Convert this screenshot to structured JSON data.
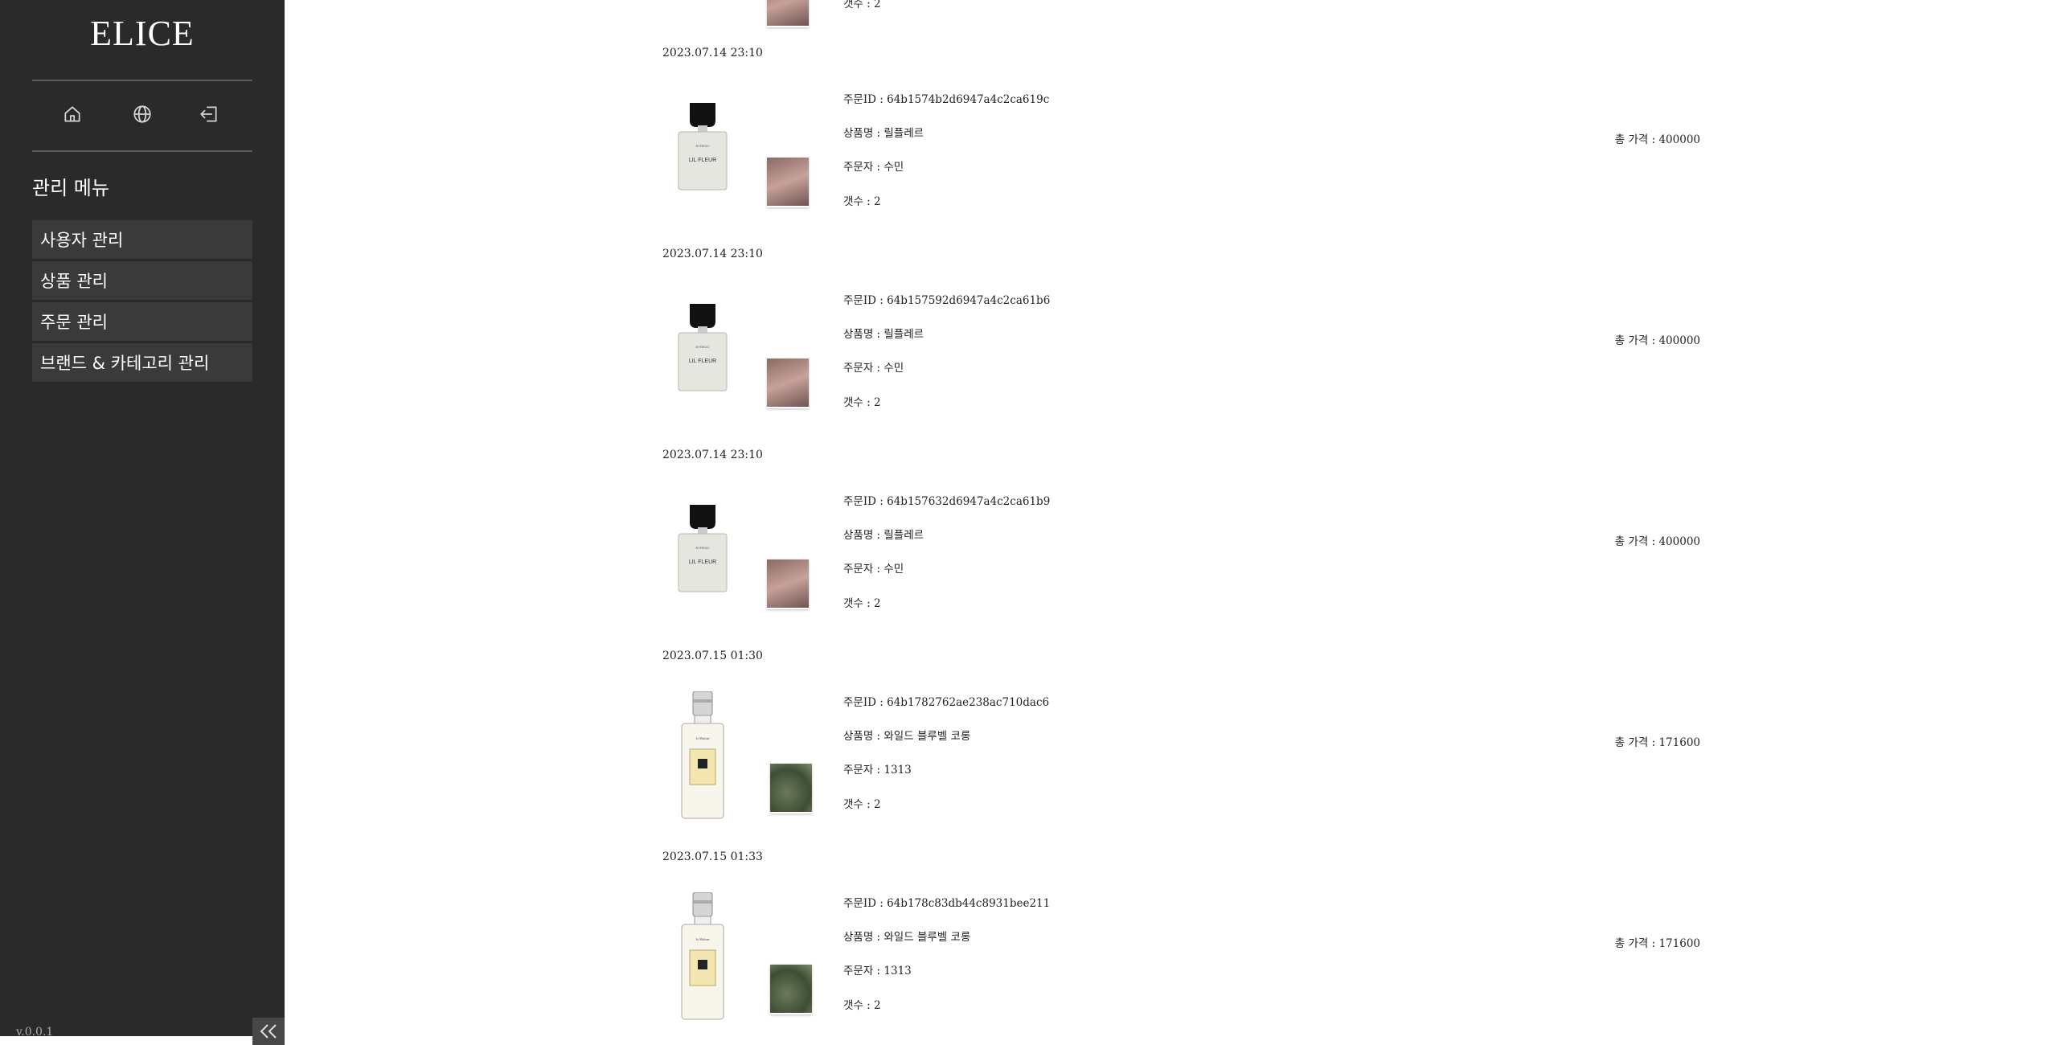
{
  "sidebar": {
    "logo": "ELICE",
    "icons": [
      "home-icon",
      "globe-icon",
      "logout-icon"
    ],
    "menu_title": "관리 메뉴",
    "menu_items": [
      {
        "label": "사용자 관리"
      },
      {
        "label": "상품 관리"
      },
      {
        "label": "주문 관리"
      },
      {
        "label": "브랜드 & 카테고리 관리"
      }
    ],
    "version": "v.0.0.1"
  },
  "top_fragment": {
    "qty_label": "갯수 : 2"
  },
  "orders": [
    {
      "date": "2023.07.14 23:10",
      "order_id": "주문ID : 64b1574b2d6947a4c2ca619c",
      "product": "상품명 : 릴플레르",
      "orderer": "주문자 : 수민",
      "qty": "갯수 : 2",
      "total": "총 가격 : 400000",
      "perfume": "byredo"
    },
    {
      "date": "2023.07.14 23:10",
      "order_id": "주문ID : 64b157592d6947a4c2ca61b6",
      "product": "상품명 : 릴플레르",
      "orderer": "주문자 : 수민",
      "qty": "갯수 : 2",
      "total": "총 가격 : 400000",
      "perfume": "byredo"
    },
    {
      "date": "2023.07.14 23:10",
      "order_id": "주문ID : 64b157632d6947a4c2ca61b9",
      "product": "상품명 : 릴플레르",
      "orderer": "주문자 : 수민",
      "qty": "갯수 : 2",
      "total": "총 가격 : 400000",
      "perfume": "byredo"
    },
    {
      "date": "2023.07.15 01:30",
      "order_id": "주문ID : 64b1782762ae238ac710dac6",
      "product": "상품명 : 와일드 블루벨 코롱",
      "orderer": "주문자 : 1313",
      "qty": "갯수 : 2",
      "total": "총 가격 : 171600",
      "perfume": "jomalone"
    },
    {
      "date": "2023.07.15 01:33",
      "order_id": "주문ID : 64b178c83db44c8931bee211",
      "product": "상품명 : 와일드 블루벨 코롱",
      "orderer": "주문자 : 1313",
      "qty": "갯수 : 2",
      "total": "총 가격 : 171600",
      "perfume": "jomalone"
    }
  ],
  "perfume_labels": {
    "byredo_brand": "BYREDO",
    "byredo_name": "LIL FLEUR",
    "jomalone_brand": "Jo Malone"
  },
  "colors": {
    "sidebar_bg": "#2a2a2a",
    "menu_item_bg": "#3a3a3a",
    "collapse_bg": "#474747"
  }
}
